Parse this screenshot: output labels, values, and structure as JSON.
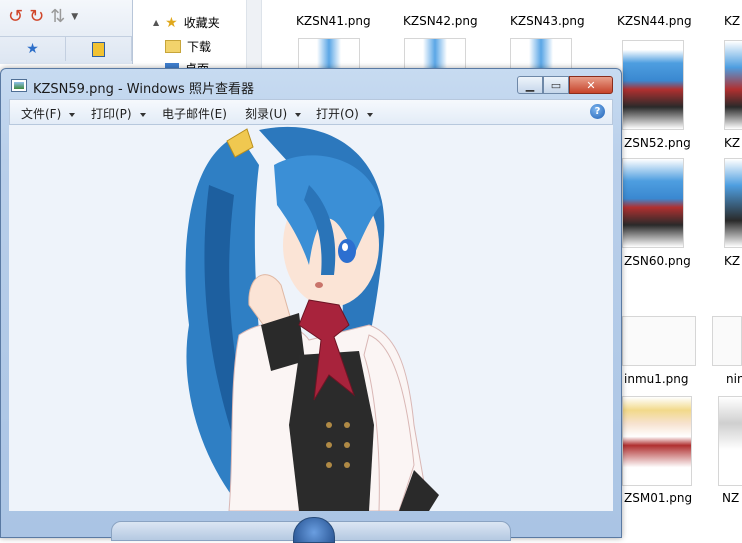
{
  "explorer": {
    "nav": {
      "favorites_label": "收藏夹",
      "downloads_label": "下载",
      "desktop_label": "桌面"
    },
    "top_files": [
      "KZSN41.png",
      "KZSN42.png",
      "KZSN43.png",
      "KZSN44.png",
      "KZ"
    ],
    "right_labels": [
      "ZSN52.png",
      "KZ",
      "ZSN60.png",
      "KZ",
      "inmu1.png",
      "nin",
      "ZSM01.png",
      "NZ"
    ]
  },
  "viewer": {
    "title": "KZSN59.png - Windows 照片查看器",
    "menu": {
      "file": "文件(F)",
      "print": "打印(P)",
      "email": "电子邮件(E)",
      "burn": "刻录(U)",
      "open": "打开(O)"
    },
    "help": "?"
  },
  "colors": {
    "accent": "#5a7aa3",
    "canvas_bg": "#eef3fa",
    "close_red": "#c7432a"
  }
}
